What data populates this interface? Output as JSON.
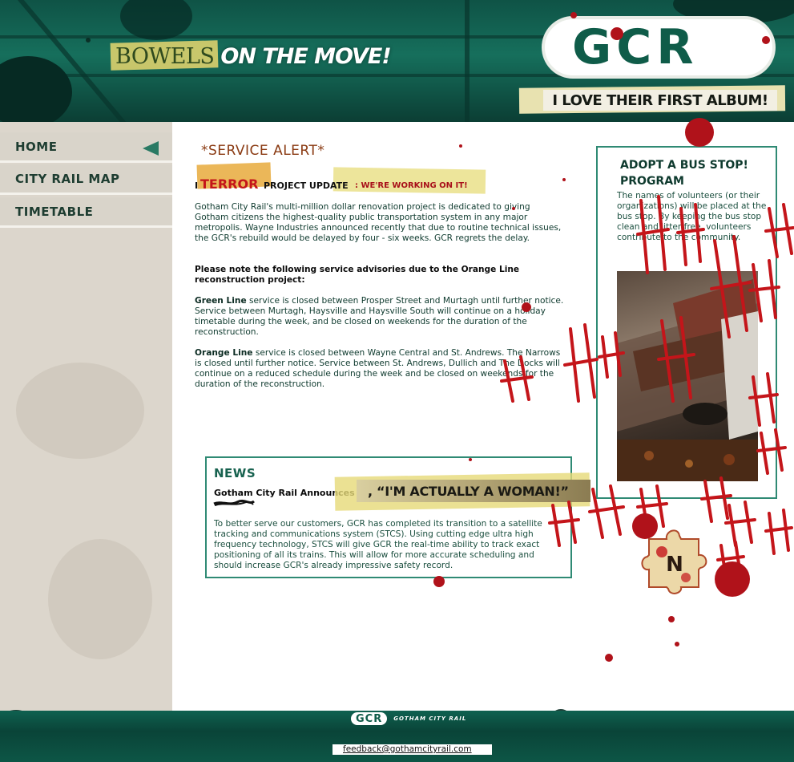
{
  "header": {
    "slogan_first": "BOWELS",
    "slogan_second": "ON THE MOVE!",
    "logo_text": "GCR",
    "tagline": "I LOVE THEIR FIRST ALBUM!"
  },
  "nav": {
    "items": [
      {
        "label": "HOME",
        "active": true
      },
      {
        "label": "CITY RAIL MAP",
        "active": false
      },
      {
        "label": "TIMETABLE",
        "active": false
      }
    ]
  },
  "alert": {
    "title": "*SERVICE ALERT*",
    "update_prefix": "I",
    "update_word": "TERROR",
    "update_label": "PROJECT UPDATE",
    "update_suffix": ": WE'RE WORKING ON IT!",
    "intro": "Gotham City Rail's multi-million dollar renovation project is dedicated to giving Gotham citizens the highest-quality public transportation system in any major metropolis. Wayne Industries announced recently that due to routine technical issues, the GCR's rebuild would be delayed by four - six weeks. GCR regrets the delay.",
    "advisory_heading": "Please note the following service advisories due to the Orange Line reconstruction project:",
    "green_line_name": "Green Line",
    "green_line_text": " service is closed between Prosper Street and Murtagh until further notice. Service between Murtagh, Haysville and Haysville South will continue on a holiday timetable during the week, and be closed on weekends for the duration of the reconstruction.",
    "orange_line_name": "Orange Line",
    "orange_line_text": " service is closed between Wayne Central and St. Andrews. The Narrows is closed until further notice. Service between St. Andrews, Dullich and The Docks will continue on a reduced schedule during the week and be closed on weekends for the duration of the reconstruction."
  },
  "bus_stop": {
    "title": "ADOPT A BUS STOP! PROGRAM",
    "text": "The names of volunteers (or their organizations) will be placed at the bus stop. By keeping the bus stop clean and litter free, volunteers contribute to the community."
  },
  "news": {
    "title": "NEWS",
    "headline": "Gotham City Rail Announces",
    "headline_overlay": ", “I'M ACTUALLY A WOMAN!”",
    "body": "To better serve our customers, GCR has completed its transition to a satellite tracking and communications system (STCS). Using cutting edge ultra high frequency technology, STCS will give GCR the real-time ability to track exact positioning of all its trains. This will allow for more accurate scheduling and should increase GCR's already impressive safety record."
  },
  "puzzle_letter": "N",
  "footer": {
    "logo_text": "GCR",
    "brand": "GOTHAM CITY RAIL",
    "email": "feedback@gothamcityrail.com"
  },
  "colors": {
    "header_green": "#166f5c",
    "brand_green": "#0f5c49",
    "panel_border": "#2f8a74",
    "alert_title": "#8a3a12",
    "graffiti_red": "#c4151a"
  }
}
